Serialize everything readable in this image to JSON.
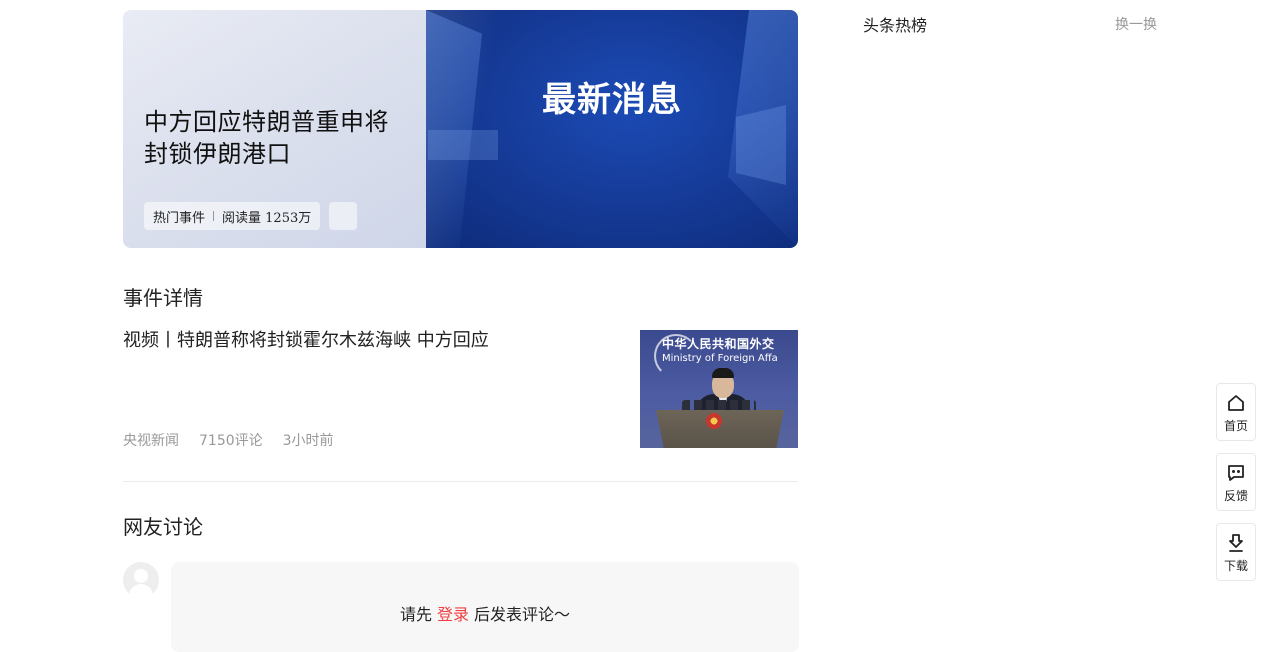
{
  "hero": {
    "title": "中方回应特朗普重申将封锁伊朗港口",
    "tag": "热门事件",
    "reads": "阅读量 1253万",
    "banner_text": "最新消息"
  },
  "event_section": {
    "title": "事件详情"
  },
  "article": {
    "title": "视频丨特朗普称将封锁霍尔木兹海峡 中方回应",
    "source": "央视新闻",
    "comments": "7150评论",
    "time": "3小时前",
    "thumb_text_cn": "中华人民共和国外交",
    "thumb_text_en": "Ministry of Foreign Affa"
  },
  "discussion": {
    "title": "网友讨论",
    "prompt_before": "请先",
    "login": "登录",
    "prompt_after": "后发表评论～"
  },
  "sidebar": {
    "hot_title": "头条热榜",
    "refresh": "换一换"
  },
  "float_toolbar": {
    "home": "首页",
    "feedback": "反馈",
    "download": "下载"
  },
  "colors": {
    "accent_red": "#f04142",
    "muted": "#999999",
    "banner_blue": "#163c9a"
  },
  "icons": [
    "home-icon",
    "feedback-icon",
    "download-icon",
    "avatar-placeholder"
  ]
}
